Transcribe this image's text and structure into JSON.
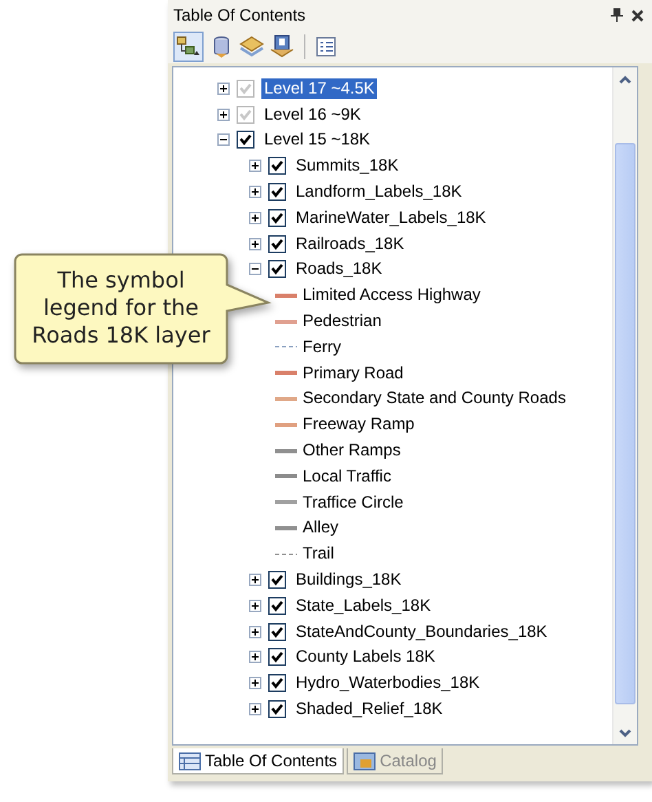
{
  "panel": {
    "title": "Table Of Contents"
  },
  "tree": [
    {
      "label": "Level 17 ~4.5K",
      "expanded": false,
      "checked": true,
      "disabled": true,
      "selected": true
    },
    {
      "label": "Level 16 ~9K",
      "expanded": false,
      "checked": true,
      "disabled": true,
      "selected": false
    },
    {
      "label": "Level 15 ~18K",
      "expanded": true,
      "checked": true,
      "disabled": false,
      "selected": false,
      "children": [
        {
          "label": "Summits_18K",
          "expanded": false,
          "checked": true,
          "disabled": false,
          "selected": false
        },
        {
          "label": "Landform_Labels_18K",
          "expanded": false,
          "checked": true,
          "disabled": false,
          "selected": false
        },
        {
          "label": "MarineWater_Labels_18K",
          "expanded": false,
          "checked": true,
          "disabled": false,
          "selected": false
        },
        {
          "label": "Railroads_18K",
          "expanded": false,
          "checked": true,
          "disabled": false,
          "selected": false
        },
        {
          "label": "Roads_18K",
          "expanded": true,
          "checked": true,
          "disabled": false,
          "selected": false,
          "children": [
            {
              "kind": "legend",
              "label": "Limited Access Highway",
              "color": "#d9806a",
              "dashed": false
            },
            {
              "kind": "legend",
              "label": "Pedestrian",
              "color": "#e0a090",
              "dashed": false
            },
            {
              "kind": "legend",
              "label": "Ferry",
              "color": "#8aa0c0",
              "dashed": true
            },
            {
              "kind": "legend",
              "label": "Primary Road",
              "color": "#d9806a",
              "dashed": false
            },
            {
              "kind": "legend",
              "label": "Secondary State and County Roads",
              "color": "#e0a888",
              "dashed": false
            },
            {
              "kind": "legend",
              "label": "Freeway Ramp",
              "color": "#e0a080",
              "dashed": false
            },
            {
              "kind": "legend",
              "label": "Other Ramps",
              "color": "#909090",
              "dashed": false
            },
            {
              "kind": "legend",
              "label": "Local Traffic",
              "color": "#8c8c8c",
              "dashed": false
            },
            {
              "kind": "legend",
              "label": "Traffice Circle",
              "color": "#a0a0a0",
              "dashed": false
            },
            {
              "kind": "legend",
              "label": "Alley",
              "color": "#909090",
              "dashed": false
            },
            {
              "kind": "legend",
              "label": "Trail",
              "color": "#909090",
              "dashed": true
            }
          ]
        },
        {
          "label": "Buildings_18K",
          "expanded": false,
          "checked": true,
          "disabled": false,
          "selected": false
        },
        {
          "label": "State_Labels_18K",
          "expanded": false,
          "checked": true,
          "disabled": false,
          "selected": false
        },
        {
          "label": "StateAndCounty_Boundaries_18K",
          "expanded": false,
          "checked": true,
          "disabled": false,
          "selected": false
        },
        {
          "label": "County Labels 18K",
          "expanded": false,
          "checked": true,
          "disabled": false,
          "selected": false
        },
        {
          "label": "Hydro_Waterbodies_18K",
          "expanded": false,
          "checked": true,
          "disabled": false,
          "selected": false
        },
        {
          "label": "Shaded_Relief_18K",
          "expanded": false,
          "checked": true,
          "disabled": false,
          "selected": false
        }
      ]
    }
  ],
  "bottom_tabs": [
    {
      "label": "Table Of Contents",
      "selected": true
    },
    {
      "label": "Catalog",
      "selected": false
    }
  ],
  "callout": {
    "text": "The symbol legend for the Roads 18K layer"
  }
}
